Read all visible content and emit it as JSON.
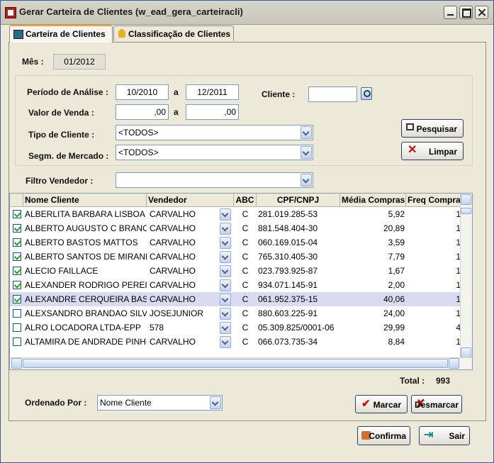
{
  "window": {
    "title": "Gerar Carteira de Clientes (w_ead_gera_carteiracli)"
  },
  "tabs": [
    {
      "label": "Carteira de Clientes",
      "active": true
    },
    {
      "label": "Classificação de Clientes",
      "active": false
    }
  ],
  "mes": {
    "label": "Mês :",
    "value": "01/2012"
  },
  "periodo": {
    "label": "Período de Análise :",
    "from": "10/2010",
    "sep": "a",
    "to": "12/2011"
  },
  "valor": {
    "label": "Valor de Venda :",
    "from": ",00",
    "sep": "a",
    "to": ",00"
  },
  "cliente": {
    "label": "Cliente :",
    "value": ""
  },
  "tipo_cliente": {
    "label": "Tipo de Cliente :",
    "value": "<TODOS>"
  },
  "segmento": {
    "label": "Segm. de Mercado :",
    "value": "<TODOS>"
  },
  "filtro_vendedor": {
    "label": "Filtro Vendedor :",
    "value": ""
  },
  "buttons": {
    "pesquisar": "Pesquisar",
    "limpar": "Limpar",
    "marcar": "Marcar",
    "desmarcar": "Desmarcar",
    "confirma": "Confirma",
    "sair": "Sair"
  },
  "grid": {
    "columns": [
      "Nome Cliente",
      "Vendedor",
      "ABC",
      "CPF/CNPJ",
      "Média Compras",
      "Freq Compras"
    ],
    "rows": [
      {
        "checked": true,
        "nome": "ALBERLITA BARBARA LISBOA S",
        "vendedor": "CARVALHO",
        "abc": "C",
        "cpf": "281.019.285-53",
        "media": "5,92",
        "freq": "1",
        "selected": false
      },
      {
        "checked": true,
        "nome": "ALBERTO AUGUSTO C BRANCO",
        "vendedor": "CARVALHO",
        "abc": "C",
        "cpf": "881.548.404-30",
        "media": "20,89",
        "freq": "1",
        "selected": false
      },
      {
        "checked": true,
        "nome": "ALBERTO BASTOS MATTOS",
        "vendedor": "CARVALHO",
        "abc": "C",
        "cpf": "060.169.015-04",
        "media": "3,59",
        "freq": "1",
        "selected": false
      },
      {
        "checked": true,
        "nome": "ALBERTO SANTOS DE MIRANDA",
        "vendedor": "CARVALHO",
        "abc": "C",
        "cpf": "765.310.405-30",
        "media": "7,79",
        "freq": "1",
        "selected": false
      },
      {
        "checked": true,
        "nome": "ALECIO FAILLACE",
        "vendedor": "CARVALHO",
        "abc": "C",
        "cpf": "023.793.925-87",
        "media": "1,67",
        "freq": "1",
        "selected": false
      },
      {
        "checked": true,
        "nome": "ALEXANDER RODRIGO PEREIRA",
        "vendedor": "CARVALHO",
        "abc": "C",
        "cpf": "934.071.145-91",
        "media": "2,00",
        "freq": "1",
        "selected": false
      },
      {
        "checked": true,
        "nome": "ALEXANDRE CERQUEIRA BASTOS",
        "vendedor": "CARVALHO",
        "abc": "C",
        "cpf": "061.952.375-15",
        "media": "40,06",
        "freq": "1",
        "selected": true
      },
      {
        "checked": false,
        "nome": "ALEXSANDRO BRANDAO SILVA",
        "vendedor": "JOSEJUNIOR",
        "abc": "C",
        "cpf": "880.603.225-91",
        "media": "24,00",
        "freq": "1",
        "selected": false
      },
      {
        "checked": false,
        "nome": "ALRO LOCADORA LTDA-EPP",
        "vendedor": "578",
        "abc": "C",
        "cpf": "05.309.825/0001-06",
        "media": "29,99",
        "freq": "4",
        "selected": false
      },
      {
        "checked": false,
        "nome": "ALTAMIRA DE ANDRADE PINHEIRO",
        "vendedor": "CARVALHO",
        "abc": "C",
        "cpf": "066.073.735-34",
        "media": "8,84",
        "freq": "1",
        "selected": false
      }
    ]
  },
  "total": {
    "label": "Total :",
    "value": "993"
  },
  "ordenado": {
    "label": "Ordenado Por :",
    "value": "Nome Cliente"
  }
}
